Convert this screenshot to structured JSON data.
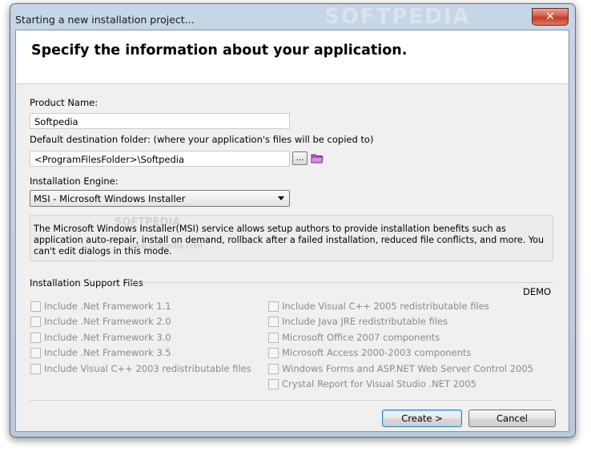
{
  "window": {
    "title": "Starting a new installation project...",
    "close_glyph": "✕",
    "watermark": "SOFTPEDIA"
  },
  "header": {
    "title": "Specify the information about your application."
  },
  "form": {
    "product_name_label": "Product Name:",
    "product_name_value": "Softpedia",
    "dest_folder_label": "Default destination folder: (where your application's files will be copied to)",
    "dest_folder_value": "<ProgramFilesFolder>\\Softpedia",
    "browse_label": "...",
    "engine_label": "Installation Engine:",
    "engine_selected": "MSI - Microsoft Windows Installer",
    "engine_description": "The Microsoft Windows Installer(MSI) service allows setup authors to provide installation benefits such as application auto-repair, install on demand, rollback after a failed installation, reduced file conflicts, and more. You can't edit dialogs in this mode.",
    "desc_watermark": "SOFTPEDIA",
    "desc_watermark2": "www.softpedia.com"
  },
  "support": {
    "title": "Installation Support Files",
    "demo_label": "DEMO",
    "left_items": [
      "Include .Net Framework 1.1",
      "Include .Net Framework 2.0",
      "Include .Net Framework 3.0",
      "Include .Net Framework 3.5",
      "Include Visual C++ 2003 redistributable files"
    ],
    "right_items": [
      "Include Visual C++ 2005 redistributable files",
      "Include Java JRE redistributable files",
      "Microsoft Office 2007 components",
      "Microsoft Access 2000-2003 components",
      "Windows Forms and ASP.NET Web Server Control 2005",
      "Crystal Report for Visual Studio .NET 2005"
    ]
  },
  "buttons": {
    "create_label": "Create >",
    "cancel_label": "Cancel"
  },
  "colors": {
    "accent": "#3c7fb1",
    "close": "#c23a22",
    "folder_icon": "#b04fc6"
  }
}
